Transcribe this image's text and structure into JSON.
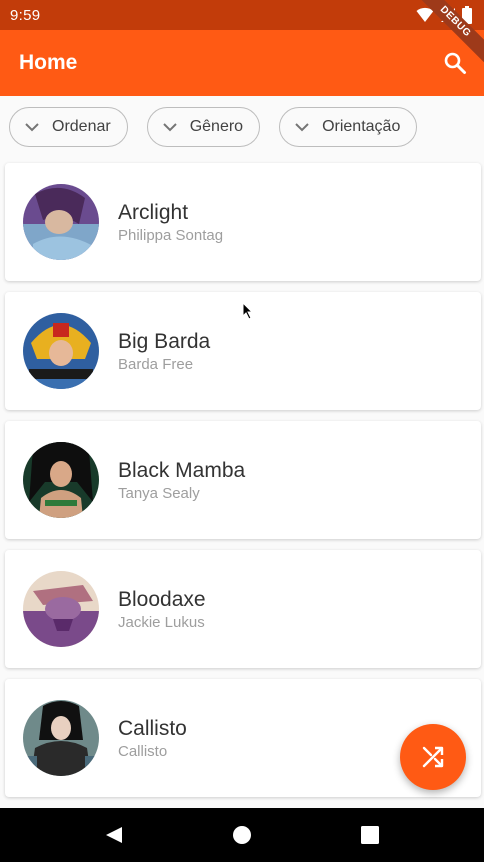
{
  "status_bar": {
    "time": "9:59"
  },
  "debug_banner": "DEBUG",
  "app_bar": {
    "title": "Home"
  },
  "filters": [
    {
      "label": "Ordenar"
    },
    {
      "label": "Gênero"
    },
    {
      "label": "Orientação"
    }
  ],
  "characters": [
    {
      "name": "Arclight",
      "real_name": "Philippa Sontag"
    },
    {
      "name": "Big Barda",
      "real_name": "Barda Free"
    },
    {
      "name": "Black Mamba",
      "real_name": "Tanya Sealy"
    },
    {
      "name": "Bloodaxe",
      "real_name": "Jackie Lukus"
    },
    {
      "name": "Callisto",
      "real_name": "Callisto"
    }
  ],
  "colors": {
    "app_bar": "#ff5a14",
    "status_bar": "#c23c0a",
    "fab": "#ff5a14"
  },
  "icons": {
    "search": "search-icon",
    "fab": "shuffle-icon",
    "chip": "chevron-down-icon"
  }
}
